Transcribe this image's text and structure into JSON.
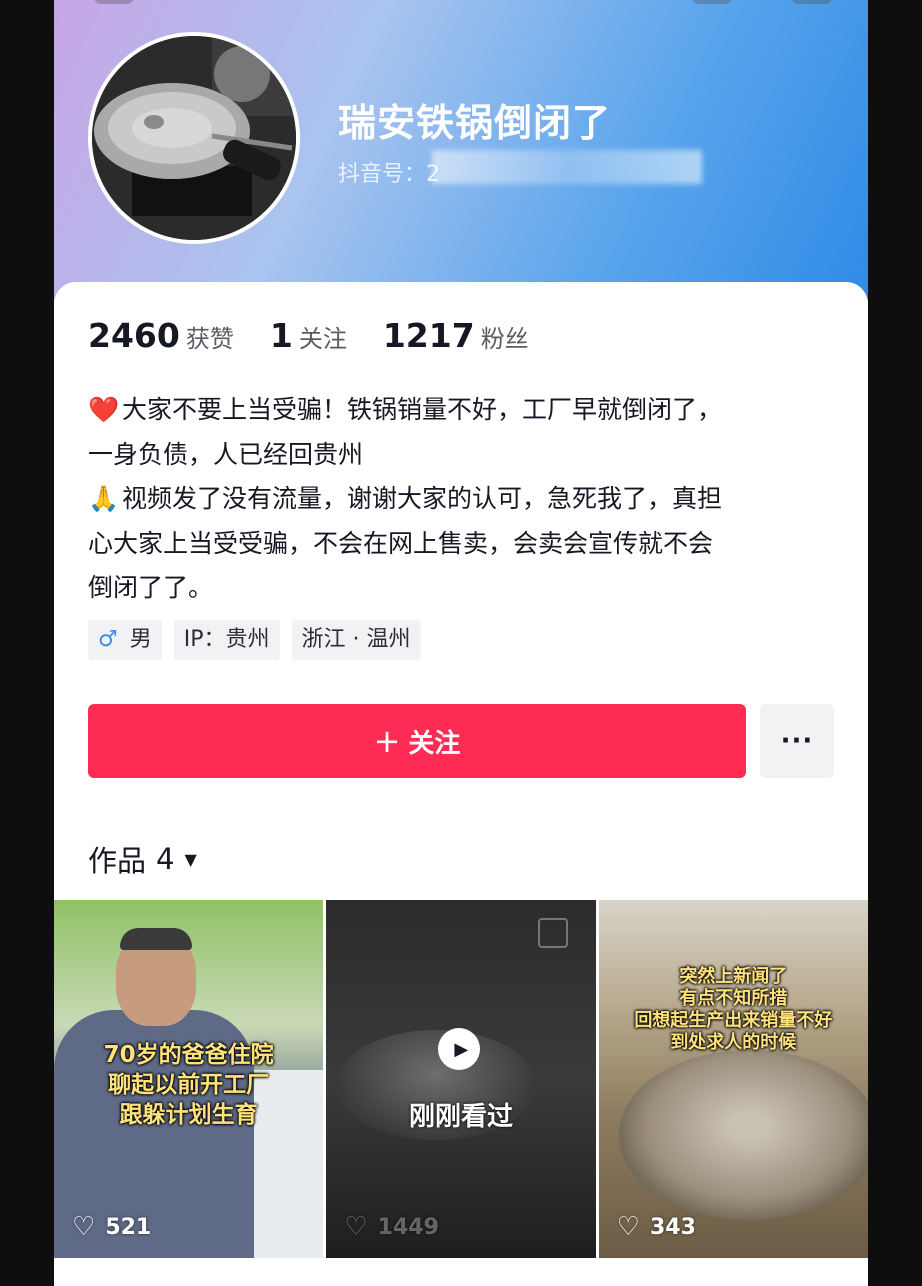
{
  "profile": {
    "username": "瑞安铁锅倒闭了",
    "douyin_id_label": "抖音号：2"
  },
  "stats": [
    {
      "value": "2460",
      "label": "获赞"
    },
    {
      "value": "1",
      "label": "关注"
    },
    {
      "value": "1217",
      "label": "粉丝"
    }
  ],
  "bio": {
    "line1_emoji": "❤️",
    "line1": "大家不要上当受骗！铁锅销量不好，工厂早就倒闭了，",
    "line2": "一身负债，人已经回贵州",
    "line3_emoji": "🙏",
    "line3": "视频发了没有流量，谢谢大家的认可，急死我了，真担",
    "line4": "心大家上当受受骗，不会在网上售卖，会卖会宣传就不会",
    "line5": "倒闭了了。"
  },
  "tags": {
    "gender": "男",
    "ip": "IP：贵州",
    "location": "浙江 · 温州"
  },
  "actions": {
    "follow_icon": "+",
    "follow_label": "关注",
    "more_label": "···"
  },
  "works": {
    "label": "作品",
    "count": "4",
    "caret": "▼"
  },
  "videos": [
    {
      "caption": [
        "70岁的爸爸住院",
        "聊起以前开工厂",
        "跟躲计划生育"
      ],
      "likes": "521"
    },
    {
      "overlay": "刚刚看过",
      "likes": "1449"
    },
    {
      "caption": [
        "突然上新闻了",
        "有点不知所措",
        "回想起生产出来销量不好",
        "到处求人的时候"
      ],
      "likes": "343"
    }
  ],
  "colors": {
    "accent": "#fe2c55",
    "header_start": "#c7a6e6",
    "header_end": "#2f8be6"
  }
}
